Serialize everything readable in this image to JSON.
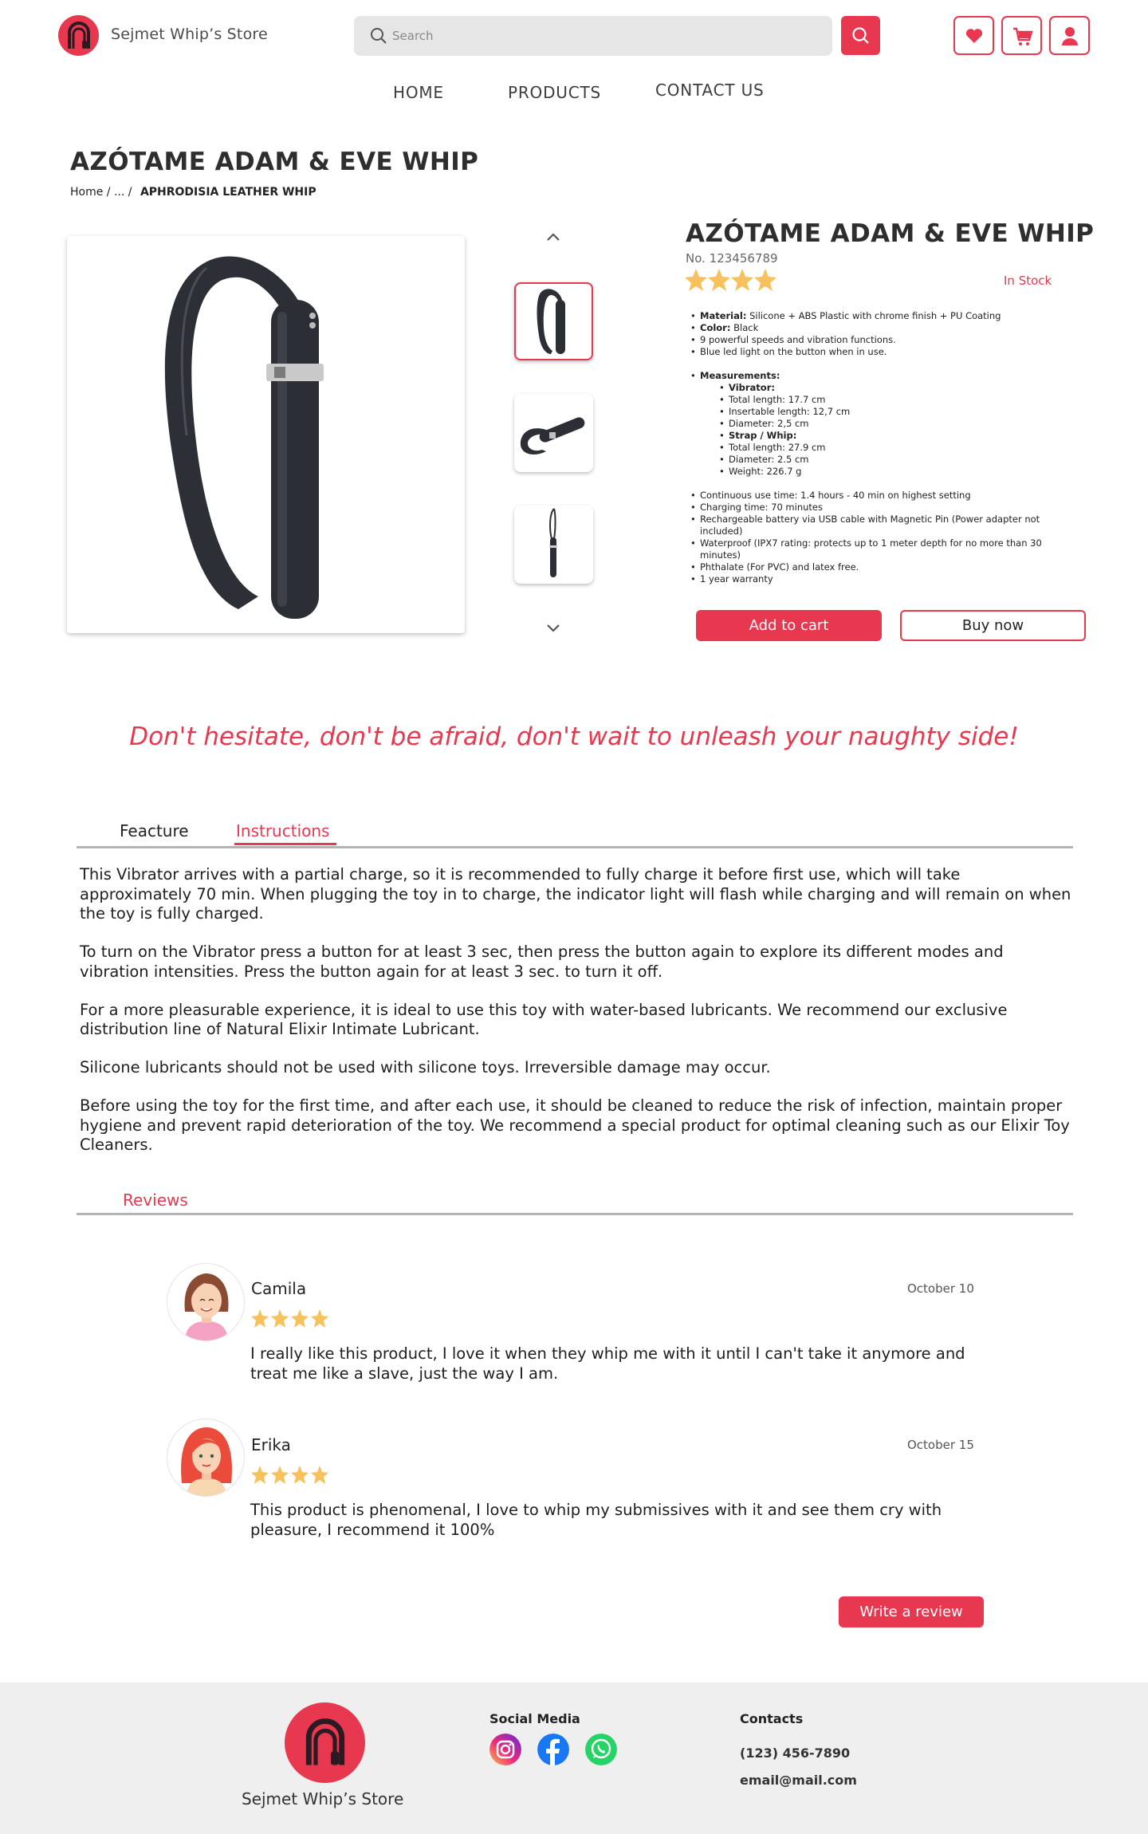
{
  "header": {
    "brand": "Sejmet Whip’s Store",
    "search_placeholder": "Search"
  },
  "nav": {
    "home": "HOME",
    "products": "PRODUCTS",
    "contact": "CONTACT US"
  },
  "page": {
    "title": "AZÓTAME ADAM & EVE WHIP",
    "breadcrumb_home": "Home",
    "breadcrumb_sep": "/ ... /",
    "breadcrumb_current": "APHRODISIA LEATHER WHIP"
  },
  "product": {
    "title": "AZÓTAME ADAM & EVE WHIP",
    "number": "No. 123456789",
    "rating": 4,
    "rating_max": 4,
    "stock": "In Stock",
    "specs": {
      "material_label": "Material:",
      "material": "Silicone + ABS Plastic with chrome finish + PU Coating",
      "color_label": "Color:",
      "color": "Black",
      "speeds": "9 powerful speeds and vibration functions.",
      "light": "Blue led light on the button when in use.",
      "measurements_label": "Measurements:",
      "vibrator_label": "Vibrator:",
      "vib_total": "Total length: 17.7 cm",
      "vib_insertable": "Insertable length: 12,7 cm",
      "vib_diameter": "Diameter: 2,5 cm",
      "strap_label": "Strap / Whip:",
      "strap_total": "Total length: 27.9 cm",
      "strap_diameter": "Diameter: 2.5 cm",
      "strap_weight": "Weight: 226.7 g",
      "use_time": "Continuous use time: 1.4 hours - 40 min on highest setting",
      "charging": "Charging time: 70 minutes",
      "battery": "Rechargeable battery via USB cable with Magnetic Pin (Power adapter not included)",
      "waterproof": "Waterproof (IPX7 rating: protects up to 1 meter depth for no more than 30 minutes)",
      "phthalate": "Phthalate (For PVC) and latex free.",
      "warranty": "1 year warranty"
    },
    "add_to_cart": "Add to cart",
    "buy_now": "Buy now"
  },
  "slogan": "Don't hesitate, don't be afraid, don't wait to unleash your naughty side!",
  "tabs": {
    "feature": "Feacture",
    "instructions": "Instructions",
    "reviews": "Reviews"
  },
  "instructions": {
    "p1": "This Vibrator arrives with a partial charge, so it is recommended to fully charge it before first use, which will take approximately 70 min. When plugging the toy in to charge, the indicator light will flash while charging and will remain on when the toy is fully charged.",
    "p2": "To turn on the Vibrator press a button for at least 3 sec, then press the button again to explore its different modes and vibration intensities. Press the button again for at least 3 sec. to turn it off.",
    "p3": "For a more pleasurable experience, it is ideal to use this toy with water-based lubricants. We recommend our exclusive distribution line of Natural Elixir Intimate Lubricant.",
    "p4": "Silicone lubricants should not be used with silicone toys. Irreversible damage may occur.",
    "p5": "Before using the toy for the first time, and after each use, it should be cleaned to reduce the risk of infection, maintain proper hygiene and prevent rapid deterioration of the toy. We recommend a special product for optimal cleaning such as our Elixir Toy Cleaners."
  },
  "reviews": [
    {
      "name": "Camila",
      "date": "October 10",
      "rating": 4,
      "text": "I really like this product, I love it when they whip me with it until I can't take it anymore and treat me like a slave, just the way I am."
    },
    {
      "name": "Erika",
      "date": "October 15",
      "rating": 4,
      "text": "This product is phenomenal, I love to whip my submissives with it and see them cry with pleasure, I recommend it 100%"
    }
  ],
  "write_review": "Write a review",
  "footer": {
    "brand": "Sejmet Whip’s Store",
    "social_title": "Social Media",
    "contacts_title": "Contacts",
    "phone": "(123) 456-7890",
    "email": "email@mail.com"
  },
  "colors": {
    "accent": "#e8384f",
    "star": "#f7c15c",
    "footer_bg": "#efefef"
  },
  "icons": [
    "logo-whip-icon",
    "search-icon",
    "heart-icon",
    "cart-icon",
    "user-icon",
    "chevron-up-icon",
    "chevron-down-icon",
    "star-icon",
    "instagram-icon",
    "facebook-icon",
    "whatsapp-icon"
  ]
}
